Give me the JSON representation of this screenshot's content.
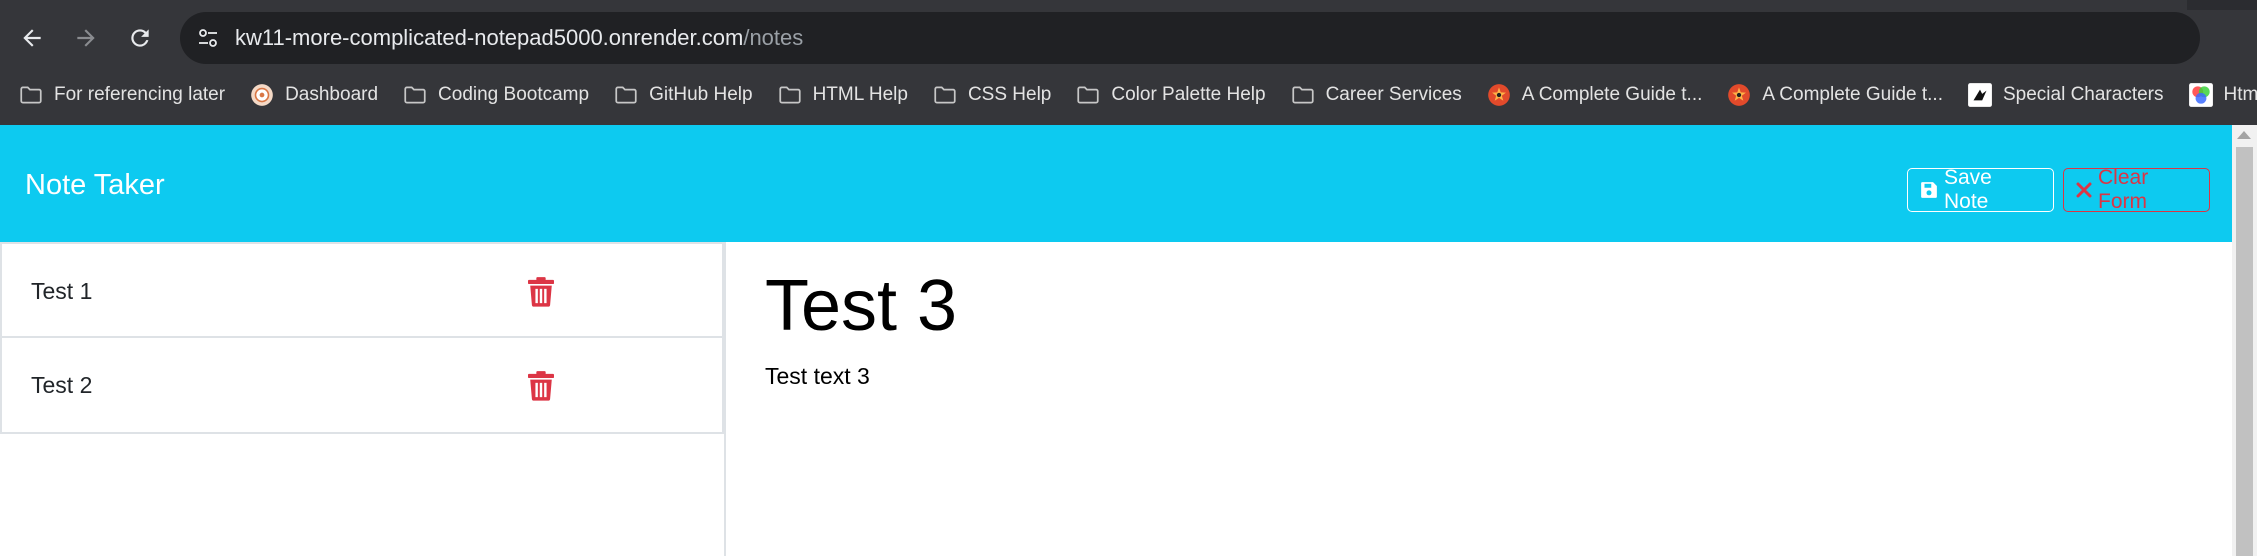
{
  "browser": {
    "url_host": "kw11-more-complicated-notepad5000.onrender.com",
    "url_path": "/notes",
    "bookmarks": [
      {
        "label": "For referencing later",
        "icon": "folder-icon"
      },
      {
        "label": "Dashboard",
        "icon": "dashboard-favicon"
      },
      {
        "label": "Coding Bootcamp",
        "icon": "folder-icon"
      },
      {
        "label": "GitHub Help",
        "icon": "folder-icon"
      },
      {
        "label": "HTML Help",
        "icon": "folder-icon"
      },
      {
        "label": "CSS Help",
        "icon": "folder-icon"
      },
      {
        "label": "Color Palette Help",
        "icon": "folder-icon"
      },
      {
        "label": "Career Services",
        "icon": "folder-icon"
      },
      {
        "label": "A Complete Guide t...",
        "icon": "css-tricks-favicon"
      },
      {
        "label": "A Complete Guide t...",
        "icon": "css-tricks-favicon"
      },
      {
        "label": "Special Characters",
        "icon": "special-characters-favicon"
      },
      {
        "label": "Html Color Cod",
        "icon": "color-wheel-favicon"
      }
    ]
  },
  "app": {
    "brand": "Note Taker",
    "save_label": "Save Note",
    "clear_label": "Clear Form",
    "notes": [
      {
        "title": "Test 1"
      },
      {
        "title": "Test 2"
      }
    ],
    "active_note": {
      "title": "Test 3",
      "text": "Test text 3"
    }
  },
  "colors": {
    "header": "#0dcaf0",
    "danger": "#dc3545",
    "chrome": "#35363a"
  }
}
